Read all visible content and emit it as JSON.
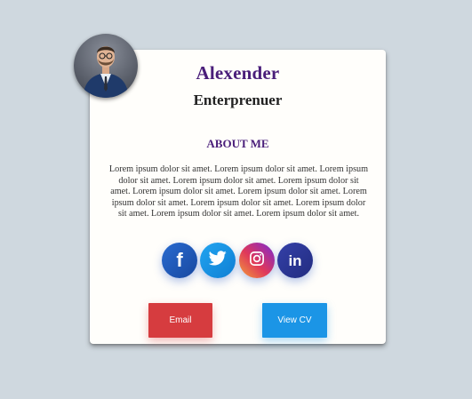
{
  "profile": {
    "name": "Alexender",
    "title": "Enterprenuer",
    "about_heading": "ABOUT ME",
    "bio": "Lorem ipsum dolor sit amet. Lorem ipsum dolor sit amet. Lorem ipsum dolor sit amet. Lorem ipsum dolor sit amet. Lorem ipsum dolor sit amet. Lorem ipsum dolor sit amet. Lorem ipsum dolor sit amet. Lorem ipsum dolor sit amet. Lorem ipsum dolor sit amet. Lorem ipsum dolor sit amet. Lorem ipsum dolor sit amet. Lorem ipsum dolor sit amet."
  },
  "social": [
    {
      "icon": "facebook-icon",
      "color": "#1e5bb8"
    },
    {
      "icon": "twitter-icon",
      "color": "#1a8fe0"
    },
    {
      "icon": "instagram-icon",
      "color": "#c0357a"
    },
    {
      "icon": "linkedin-icon",
      "color": "#2a3590"
    }
  ],
  "buttons": {
    "email_label": "Email",
    "email_color": "#d43a3f",
    "cv_label": "View CV",
    "cv_color": "#1b95e6"
  },
  "colors": {
    "background": "#cfd8df",
    "card": "#fffefb",
    "accent": "#4a1e7a"
  }
}
